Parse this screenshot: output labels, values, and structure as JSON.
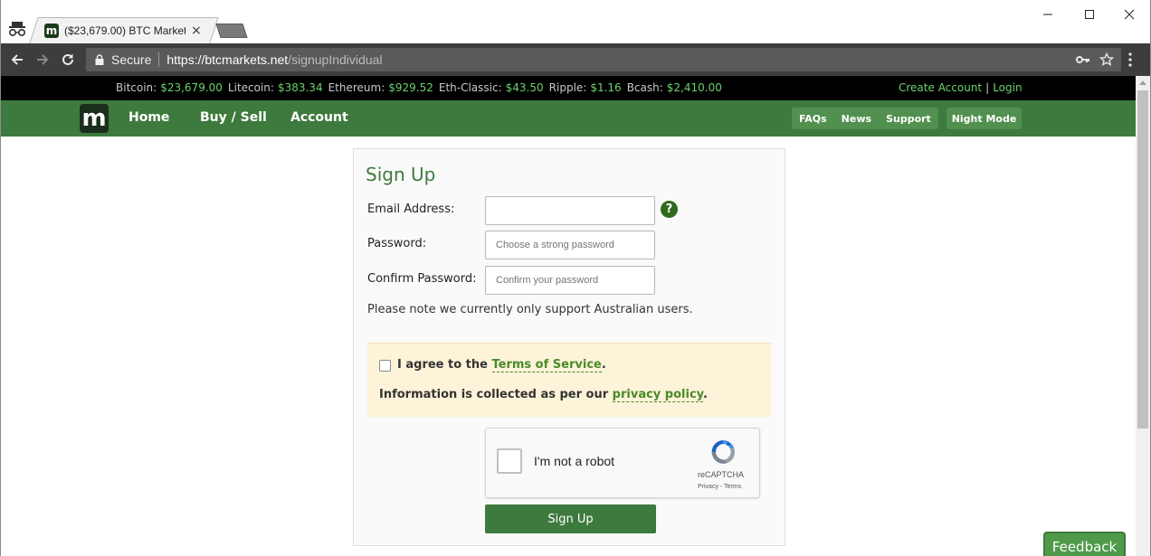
{
  "browser": {
    "tab_title": "($23,679.00) BTC Markets",
    "tab_close": "×",
    "favicon_letter": "m",
    "secure_label": "Secure",
    "url_host": "https://btcmarkets.net",
    "url_path": "/signupIndividual",
    "window_controls": [
      "minimize",
      "maximize",
      "close"
    ]
  },
  "ticker": {
    "items": [
      {
        "name": "Bitcoin:",
        "value": "$23,679.00"
      },
      {
        "name": "Litecoin:",
        "value": "$383.34"
      },
      {
        "name": "Ethereum:",
        "value": "$929.52"
      },
      {
        "name": "Eth-Classic:",
        "value": "$43.50"
      },
      {
        "name": "Ripple:",
        "value": "$1.16"
      },
      {
        "name": "Bcash:",
        "value": "$2,410.00"
      }
    ],
    "create_account": "Create Account",
    "separator": "|",
    "login": "Login"
  },
  "nav": {
    "logo_letter": "m",
    "links": [
      "Home",
      "Buy / Sell",
      "Account"
    ],
    "pills": [
      "FAQs",
      "News",
      "Support"
    ],
    "night_mode": "Night Mode"
  },
  "signup": {
    "title": "Sign Up",
    "email_label": "Email Address:",
    "email_value": "",
    "password_label": "Password:",
    "password_placeholder": "Choose a strong password",
    "confirm_label": "Confirm Password:",
    "confirm_placeholder": "Confirm your password",
    "help_glyph": "?",
    "note": "Please note we currently only support Australian users.",
    "agree_prefix": "I agree to the ",
    "terms_link": "Terms of Service",
    "agree_suffix": ".",
    "info_prefix": "Information is collected as per our ",
    "privacy_link": "privacy policy",
    "info_suffix": ".",
    "recaptcha_label": "I'm not a robot",
    "recaptcha_brand": "reCAPTCHA",
    "recaptcha_terms": "Privacy - Terms",
    "submit": "Sign Up"
  },
  "feedback": "Feedback",
  "colors": {
    "brand_green": "#3e7a3e",
    "ticker_green": "#6bd16b",
    "notice_bg": "#fcf3d8"
  }
}
